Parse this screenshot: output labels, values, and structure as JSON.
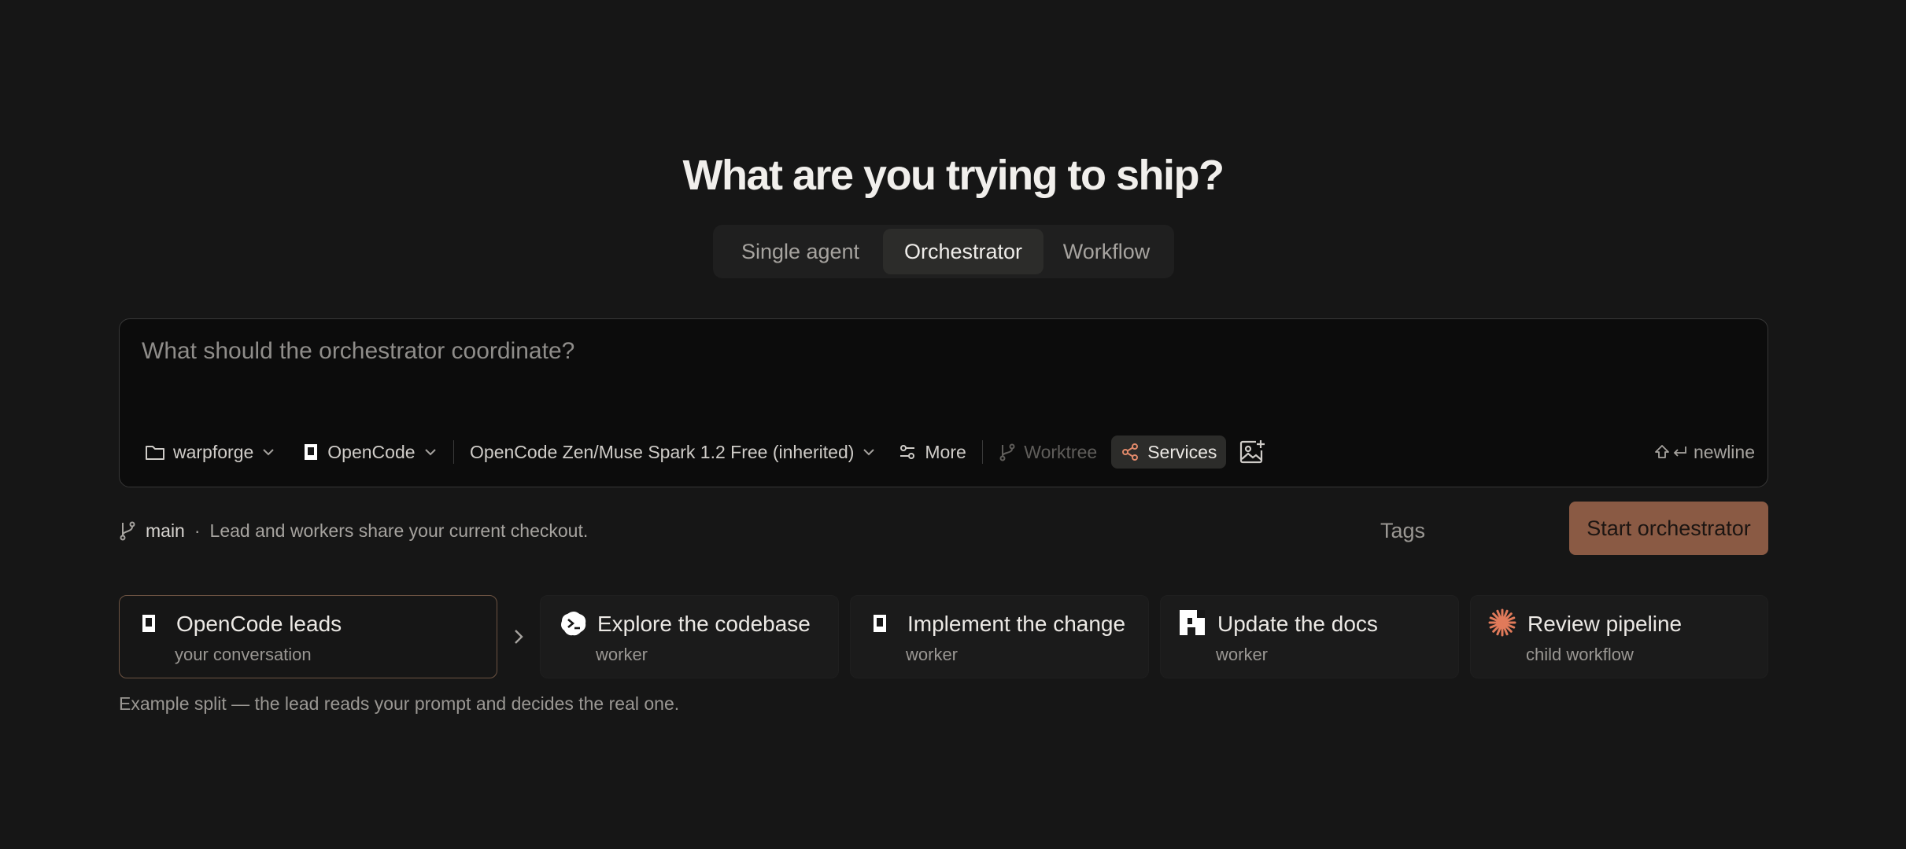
{
  "heading": "What are you trying to ship?",
  "modes": [
    {
      "label": "Single agent",
      "active": false
    },
    {
      "label": "Orchestrator",
      "active": true
    },
    {
      "label": "Workflow",
      "active": false
    }
  ],
  "prompt": {
    "placeholder": "What should the orchestrator coordinate?",
    "value": ""
  },
  "toolbar": {
    "project": "warpforge",
    "agent": "OpenCode",
    "model": "OpenCode Zen/Muse Spark 1.2 Free (inherited)",
    "more": "More",
    "worktree": "Worktree",
    "services": "Services",
    "newline_hint": "newline",
    "services_icon_color": "#e0896a"
  },
  "branch": {
    "name": "main",
    "separator": "·",
    "description": "Lead and workers share your current checkout."
  },
  "tags_label": "Tags",
  "start_button": "Start orchestrator",
  "accent_color": "#8a5a44",
  "cards": [
    {
      "title": "OpenCode leads",
      "subtitle": "your conversation",
      "icon": "opencode-icon"
    },
    {
      "title": "Explore the codebase",
      "subtitle": "worker",
      "icon": "terminal-blob-icon"
    },
    {
      "title": "Implement the change",
      "subtitle": "worker",
      "icon": "opencode-icon"
    },
    {
      "title": "Update the docs",
      "subtitle": "worker",
      "icon": "pixel-blocks-icon"
    },
    {
      "title": "Review pipeline",
      "subtitle": "child workflow",
      "icon": "starburst-icon"
    }
  ],
  "footnote": "Example split — the lead reads your prompt and decides the real one."
}
